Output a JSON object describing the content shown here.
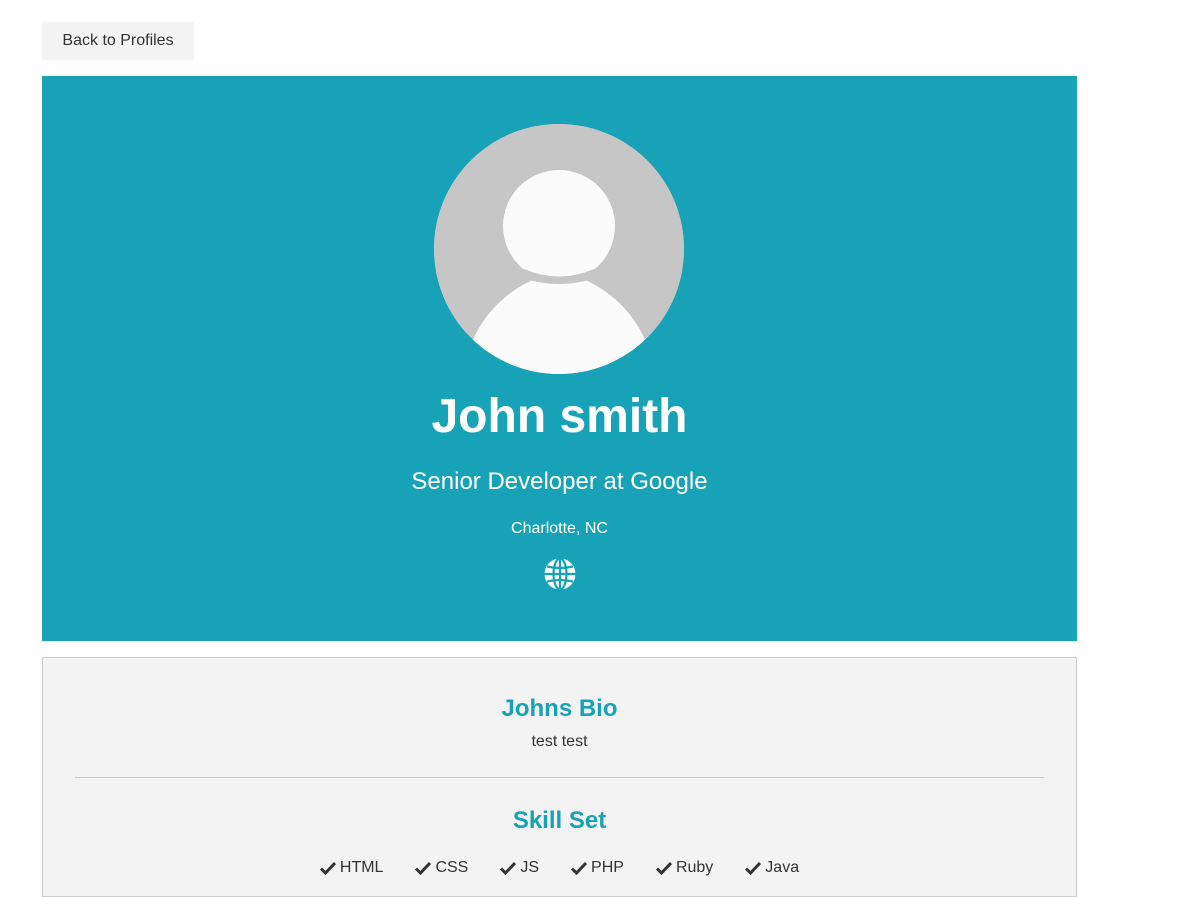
{
  "nav": {
    "back_label": "Back to Profiles"
  },
  "profile": {
    "name": "John smith",
    "title": "Senior Developer at Google",
    "location": "Charlotte, NC",
    "website_icon": "globe-icon",
    "avatar_icon": "default-avatar"
  },
  "about": {
    "bio_heading": "Johns Bio",
    "bio_text": "test test",
    "skills_heading": "Skill Set",
    "skills": [
      "HTML",
      "CSS",
      "JS",
      "PHP",
      "Ruby",
      "Java"
    ],
    "skill_icon": "check-icon"
  },
  "colors": {
    "accent": "#17a2b8",
    "avatar_bg": "#c6c6c6",
    "card_bg": "#f3f3f3",
    "button_bg": "#f4f4f4"
  }
}
